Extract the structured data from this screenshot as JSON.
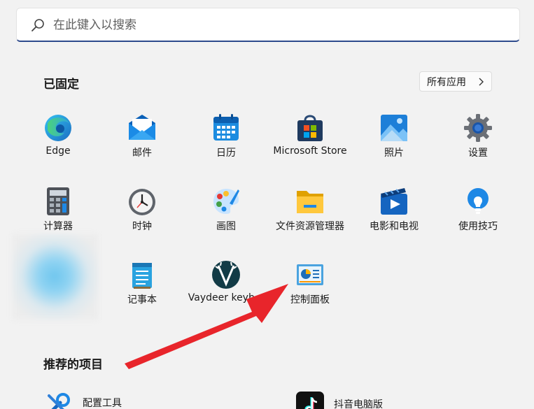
{
  "search": {
    "placeholder": "在此键入以搜索"
  },
  "pinned": {
    "title": "已固定",
    "all_apps_label": "所有应用",
    "apps": [
      {
        "label": "Edge",
        "icon": "edge-icon"
      },
      {
        "label": "邮件",
        "icon": "mail-icon"
      },
      {
        "label": "日历",
        "icon": "calendar-icon"
      },
      {
        "label": "Microsoft Store",
        "icon": "store-icon"
      },
      {
        "label": "照片",
        "icon": "photos-icon"
      },
      {
        "label": "设置",
        "icon": "settings-icon"
      },
      {
        "label": "计算器",
        "icon": "calculator-icon"
      },
      {
        "label": "时钟",
        "icon": "clock-icon"
      },
      {
        "label": "画图",
        "icon": "paint-icon"
      },
      {
        "label": "文件资源管理器",
        "icon": "folder-icon"
      },
      {
        "label": "电影和电视",
        "icon": "movies-icon"
      },
      {
        "label": "使用技巧",
        "icon": "tips-icon"
      },
      {
        "label": "记事本",
        "icon": "notepad-icon"
      },
      {
        "label": "Vaydeer keyb...",
        "icon": "vaydeer-icon"
      },
      {
        "label": "控制面板",
        "icon": "control-panel-icon"
      }
    ]
  },
  "recommended": {
    "title": "推荐的项目",
    "items": [
      {
        "label": "配置工具",
        "icon": "tools-icon"
      },
      {
        "label": "抖音电脑版",
        "icon": "douyin-icon"
      }
    ]
  },
  "colors": {
    "accent": "#2d4a8c",
    "arrow": "#e8252b"
  }
}
